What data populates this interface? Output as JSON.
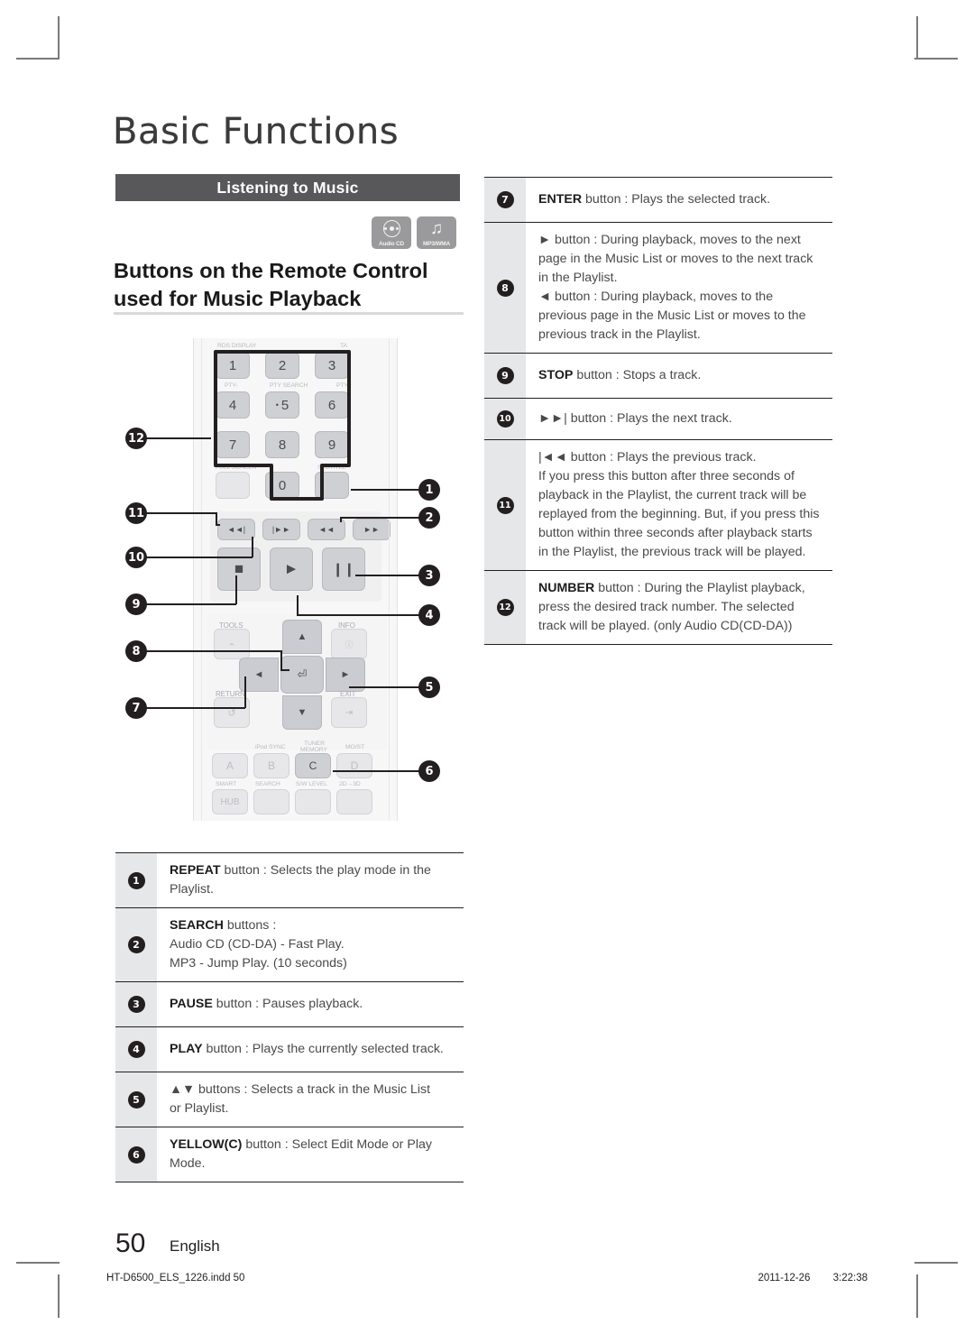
{
  "page": {
    "chapter_title": "Basic Functions",
    "section_bar": "Listening to Music",
    "main_heading_line1": "Buttons on the Remote Control",
    "main_heading_line2": "used for Music Playback",
    "page_number": "50",
    "language": "English",
    "footer_file": "HT-D6500_ELS_1226.indd   50",
    "footer_date": "2011-12-26",
    "footer_time": "3:22:38"
  },
  "badges": [
    {
      "icon": "audio-cd-icon",
      "label": "Audio CD"
    },
    {
      "icon": "music-note-icon",
      "label": "MP3/WMA"
    }
  ],
  "remote": {
    "keypad_labels": {
      "rds_display": "RDS DISPLAY",
      "ta": "TA",
      "pty_minus": "PTY-",
      "pty_search": "PTY SEARCH",
      "pty_plus": "PTY+"
    },
    "number_keys": [
      "1",
      "2",
      "3",
      "4",
      "5",
      "6",
      "7",
      "8",
      "9",
      "0"
    ],
    "function_labels": {
      "tools": "TOOLS",
      "info": "INFO",
      "return": "RETURN",
      "exit": "EXIT",
      "ipod_sync": "iPod SYNC",
      "tuner_memory_l1": "TUNER",
      "tuner_memory_l2": "MEMORY",
      "mo_st": "MO/ST",
      "smart": "SMART",
      "search": "SEARCH",
      "sw_level": "S/W LEVEL",
      "two_d_three_d": "2D→3D",
      "hub": "HUB"
    },
    "color_keys": [
      "A",
      "B",
      "C",
      "D"
    ],
    "transport_glyphs": {
      "prev": "◄◄|",
      "next": "|►►",
      "rew": "◄◄",
      "ff": "►►",
      "stop": "■",
      "play": "►",
      "pause": "❙❙"
    },
    "callouts_left": [
      "12",
      "11",
      "10",
      "9",
      "8",
      "7"
    ],
    "callouts_right": [
      "1",
      "2",
      "3",
      "4",
      "5",
      "6"
    ]
  },
  "table_left": {
    "rows": [
      {
        "num": "1",
        "lines": [
          {
            "bold": "REPEAT",
            "rest": " button : Selects the play mode in the"
          },
          {
            "bold": "",
            "rest": "Playlist."
          }
        ]
      },
      {
        "num": "2",
        "lines": [
          {
            "bold": "SEARCH",
            "rest": " buttons :"
          },
          {
            "bold": "",
            "rest": "Audio CD (CD-DA) - Fast Play."
          },
          {
            "bold": "",
            "rest": "MP3 - Jump Play. (10 seconds)"
          }
        ]
      },
      {
        "num": "3",
        "lines": [
          {
            "bold": "PAUSE",
            "rest": " button : Pauses playback."
          }
        ]
      },
      {
        "num": "4",
        "lines": [
          {
            "bold": "PLAY",
            "rest": " button : Plays the currently selected track."
          }
        ]
      },
      {
        "num": "5",
        "lines": [
          {
            "bold": "",
            "rest": "▲▼ buttons : Selects a track in the Music List"
          },
          {
            "bold": "",
            "rest": "or Playlist."
          }
        ]
      },
      {
        "num": "6",
        "lines": [
          {
            "bold": "YELLOW(C)",
            "rest": " button : Select Edit Mode or Play"
          },
          {
            "bold": "",
            "rest": "Mode."
          }
        ]
      }
    ]
  },
  "table_right": {
    "rows": [
      {
        "num": "7",
        "lines": [
          {
            "bold": "ENTER",
            "rest": " button : Plays the selected track."
          }
        ]
      },
      {
        "num": "8",
        "lines": [
          {
            "bold": "",
            "rest": "► button : During playback, moves to the next"
          },
          {
            "bold": "",
            "rest": "page in the Music List or moves to the next track"
          },
          {
            "bold": "",
            "rest": "in the Playlist."
          },
          {
            "bold": "",
            "rest": "◄ button : During playback, moves to the"
          },
          {
            "bold": "",
            "rest": "previous page in the Music List or moves to the"
          },
          {
            "bold": "",
            "rest": "previous track in the Playlist."
          }
        ]
      },
      {
        "num": "9",
        "lines": [
          {
            "bold": "STOP",
            "rest": " button : Stops a track."
          }
        ]
      },
      {
        "num": "10",
        "lines": [
          {
            "bold": "",
            "rest": "►►| button : Plays the next track."
          }
        ]
      },
      {
        "num": "11",
        "lines": [
          {
            "bold": "",
            "rest": "|◄◄ button : Plays the previous track."
          },
          {
            "bold": "",
            "rest": "If you press this button after three seconds of"
          },
          {
            "bold": "",
            "rest": "playback in the Playlist, the current track will be"
          },
          {
            "bold": "",
            "rest": "replayed from the beginning. But, if you press this"
          },
          {
            "bold": "",
            "rest": "button within three seconds after playback starts"
          },
          {
            "bold": "",
            "rest": "in the Playlist, the previous track will be played."
          }
        ]
      },
      {
        "num": "12",
        "lines": [
          {
            "bold": "NUMBER",
            "rest": " button : During the Playlist playback,"
          },
          {
            "bold": "",
            "rest": "press the desired track number. The selected"
          },
          {
            "bold": "",
            "rest": "track will be played. (only Audio CD(CD-DA))"
          }
        ]
      }
    ]
  }
}
